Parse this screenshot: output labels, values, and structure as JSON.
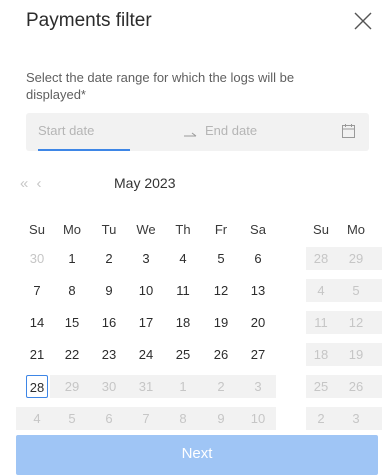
{
  "title": "Payments filter",
  "description": "Select the date range for which the logs will be displayed*",
  "range": {
    "start_placeholder": "Start date",
    "end_placeholder": "End date"
  },
  "calendar": {
    "nav": "« ‹",
    "month_label": "May 2023",
    "weekdays": [
      "Su",
      "Mo",
      "Tu",
      "We",
      "Th",
      "Fr",
      "Sa"
    ],
    "right_weekdays": [
      "Su",
      "Mo"
    ],
    "weeks": [
      [
        {
          "d": "30",
          "m": true
        },
        {
          "d": "1"
        },
        {
          "d": "2"
        },
        {
          "d": "3"
        },
        {
          "d": "4"
        },
        {
          "d": "5"
        },
        {
          "d": "6"
        }
      ],
      [
        {
          "d": "7"
        },
        {
          "d": "8"
        },
        {
          "d": "9"
        },
        {
          "d": "10"
        },
        {
          "d": "11"
        },
        {
          "d": "12"
        },
        {
          "d": "13"
        }
      ],
      [
        {
          "d": "14"
        },
        {
          "d": "15"
        },
        {
          "d": "16"
        },
        {
          "d": "17"
        },
        {
          "d": "18"
        },
        {
          "d": "19"
        },
        {
          "d": "20"
        }
      ],
      [
        {
          "d": "21"
        },
        {
          "d": "22"
        },
        {
          "d": "23"
        },
        {
          "d": "24"
        },
        {
          "d": "25"
        },
        {
          "d": "26"
        },
        {
          "d": "27"
        }
      ],
      [
        {
          "d": "28",
          "today": true
        },
        {
          "d": "29",
          "m": true
        },
        {
          "d": "30",
          "m": true
        },
        {
          "d": "31",
          "m": true
        },
        {
          "d": "1",
          "m": true
        },
        {
          "d": "2",
          "m": true
        },
        {
          "d": "3",
          "m": true
        }
      ],
      [
        {
          "d": "4",
          "m": true
        },
        {
          "d": "5",
          "m": true
        },
        {
          "d": "6",
          "m": true
        },
        {
          "d": "7",
          "m": true
        },
        {
          "d": "8",
          "m": true
        },
        {
          "d": "9",
          "m": true
        },
        {
          "d": "10",
          "m": true
        }
      ]
    ],
    "right_weeks": [
      [
        "28",
        "29"
      ],
      [
        "4",
        "5"
      ],
      [
        "11",
        "12"
      ],
      [
        "18",
        "19"
      ],
      [
        "25",
        "26"
      ],
      [
        "2",
        "3"
      ]
    ]
  },
  "next_label": "Next",
  "colors": {
    "accent": "#3e86e6",
    "button": "#9fc5f5",
    "cell_bg": "#f2f2f2"
  }
}
